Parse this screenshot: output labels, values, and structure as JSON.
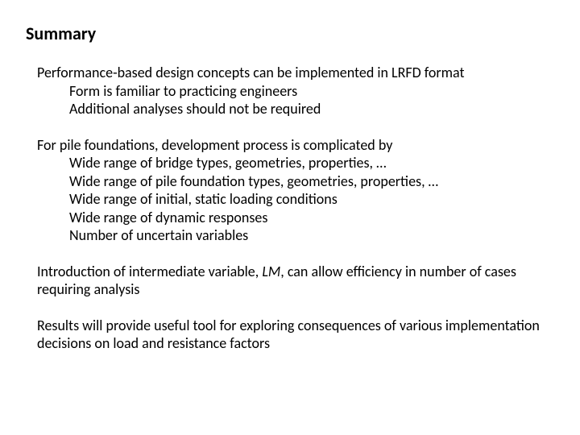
{
  "title": "Summary",
  "b1": {
    "lead": "Performance-based design concepts can be implemented in LRFD format",
    "s1": "Form is familiar to practicing engineers",
    "s2": "Additional analyses should not be required"
  },
  "b2": {
    "lead": "For pile foundations, development process is complicated by",
    "s1": "Wide range of bridge types, geometries, properties, …",
    "s2": "Wide range of pile foundation types, geometries, properties, …",
    "s3": "Wide range of initial, static loading conditions",
    "s4": "Wide range of dynamic responses",
    "s5": "Number of uncertain variables"
  },
  "b3": {
    "pre": "Introduction of intermediate variable, ",
    "var": "LM",
    "post": ", can allow efficiency in number of cases requiring analysis"
  },
  "b4": {
    "text": "Results will provide useful tool for exploring consequences of various implementation decisions on load and resistance factors"
  }
}
